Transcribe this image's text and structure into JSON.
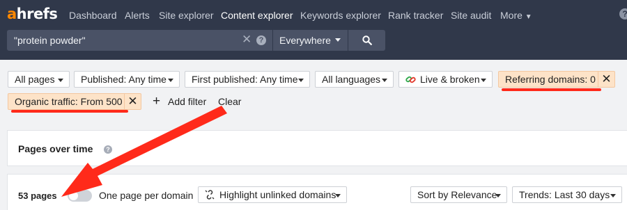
{
  "brand": {
    "logo_a": "a",
    "logo_rest": "hrefs",
    "accent": "#ff8800"
  },
  "nav": {
    "items": [
      "Dashboard",
      "Alerts",
      "Site explorer",
      "Content explorer",
      "Keywords explorer",
      "Rank tracker",
      "Site audit",
      "More"
    ],
    "active": "Content explorer",
    "help_icon": "?"
  },
  "search": {
    "query": "\"protein powder\"",
    "scope": "Everywhere",
    "clear_icon": "close-icon",
    "help_icon": "?",
    "submit_icon": "search-icon"
  },
  "filters": {
    "all_pages": "All pages",
    "published": "Published: Any time",
    "first_published": "First published: Any time",
    "languages": "All languages",
    "live_broken": "Live & broken",
    "referring_domains": "Referring domains: 0",
    "organic_traffic": "Organic traffic: From 500",
    "add_filter": "Add filter",
    "clear": "Clear",
    "highlight_color": "#fde3c8",
    "annotation_color": "#ff2a1a"
  },
  "pages_over_time": {
    "title": "Pages over time",
    "help_icon": "?"
  },
  "results": {
    "count": "53 pages",
    "one_page_per_domain": "One page per domain",
    "one_page_per_domain_on": false,
    "highlight_unlinked": "Highlight unlinked domains",
    "sort": "Sort by Relevance",
    "trends": "Trends: Last 30 days"
  }
}
